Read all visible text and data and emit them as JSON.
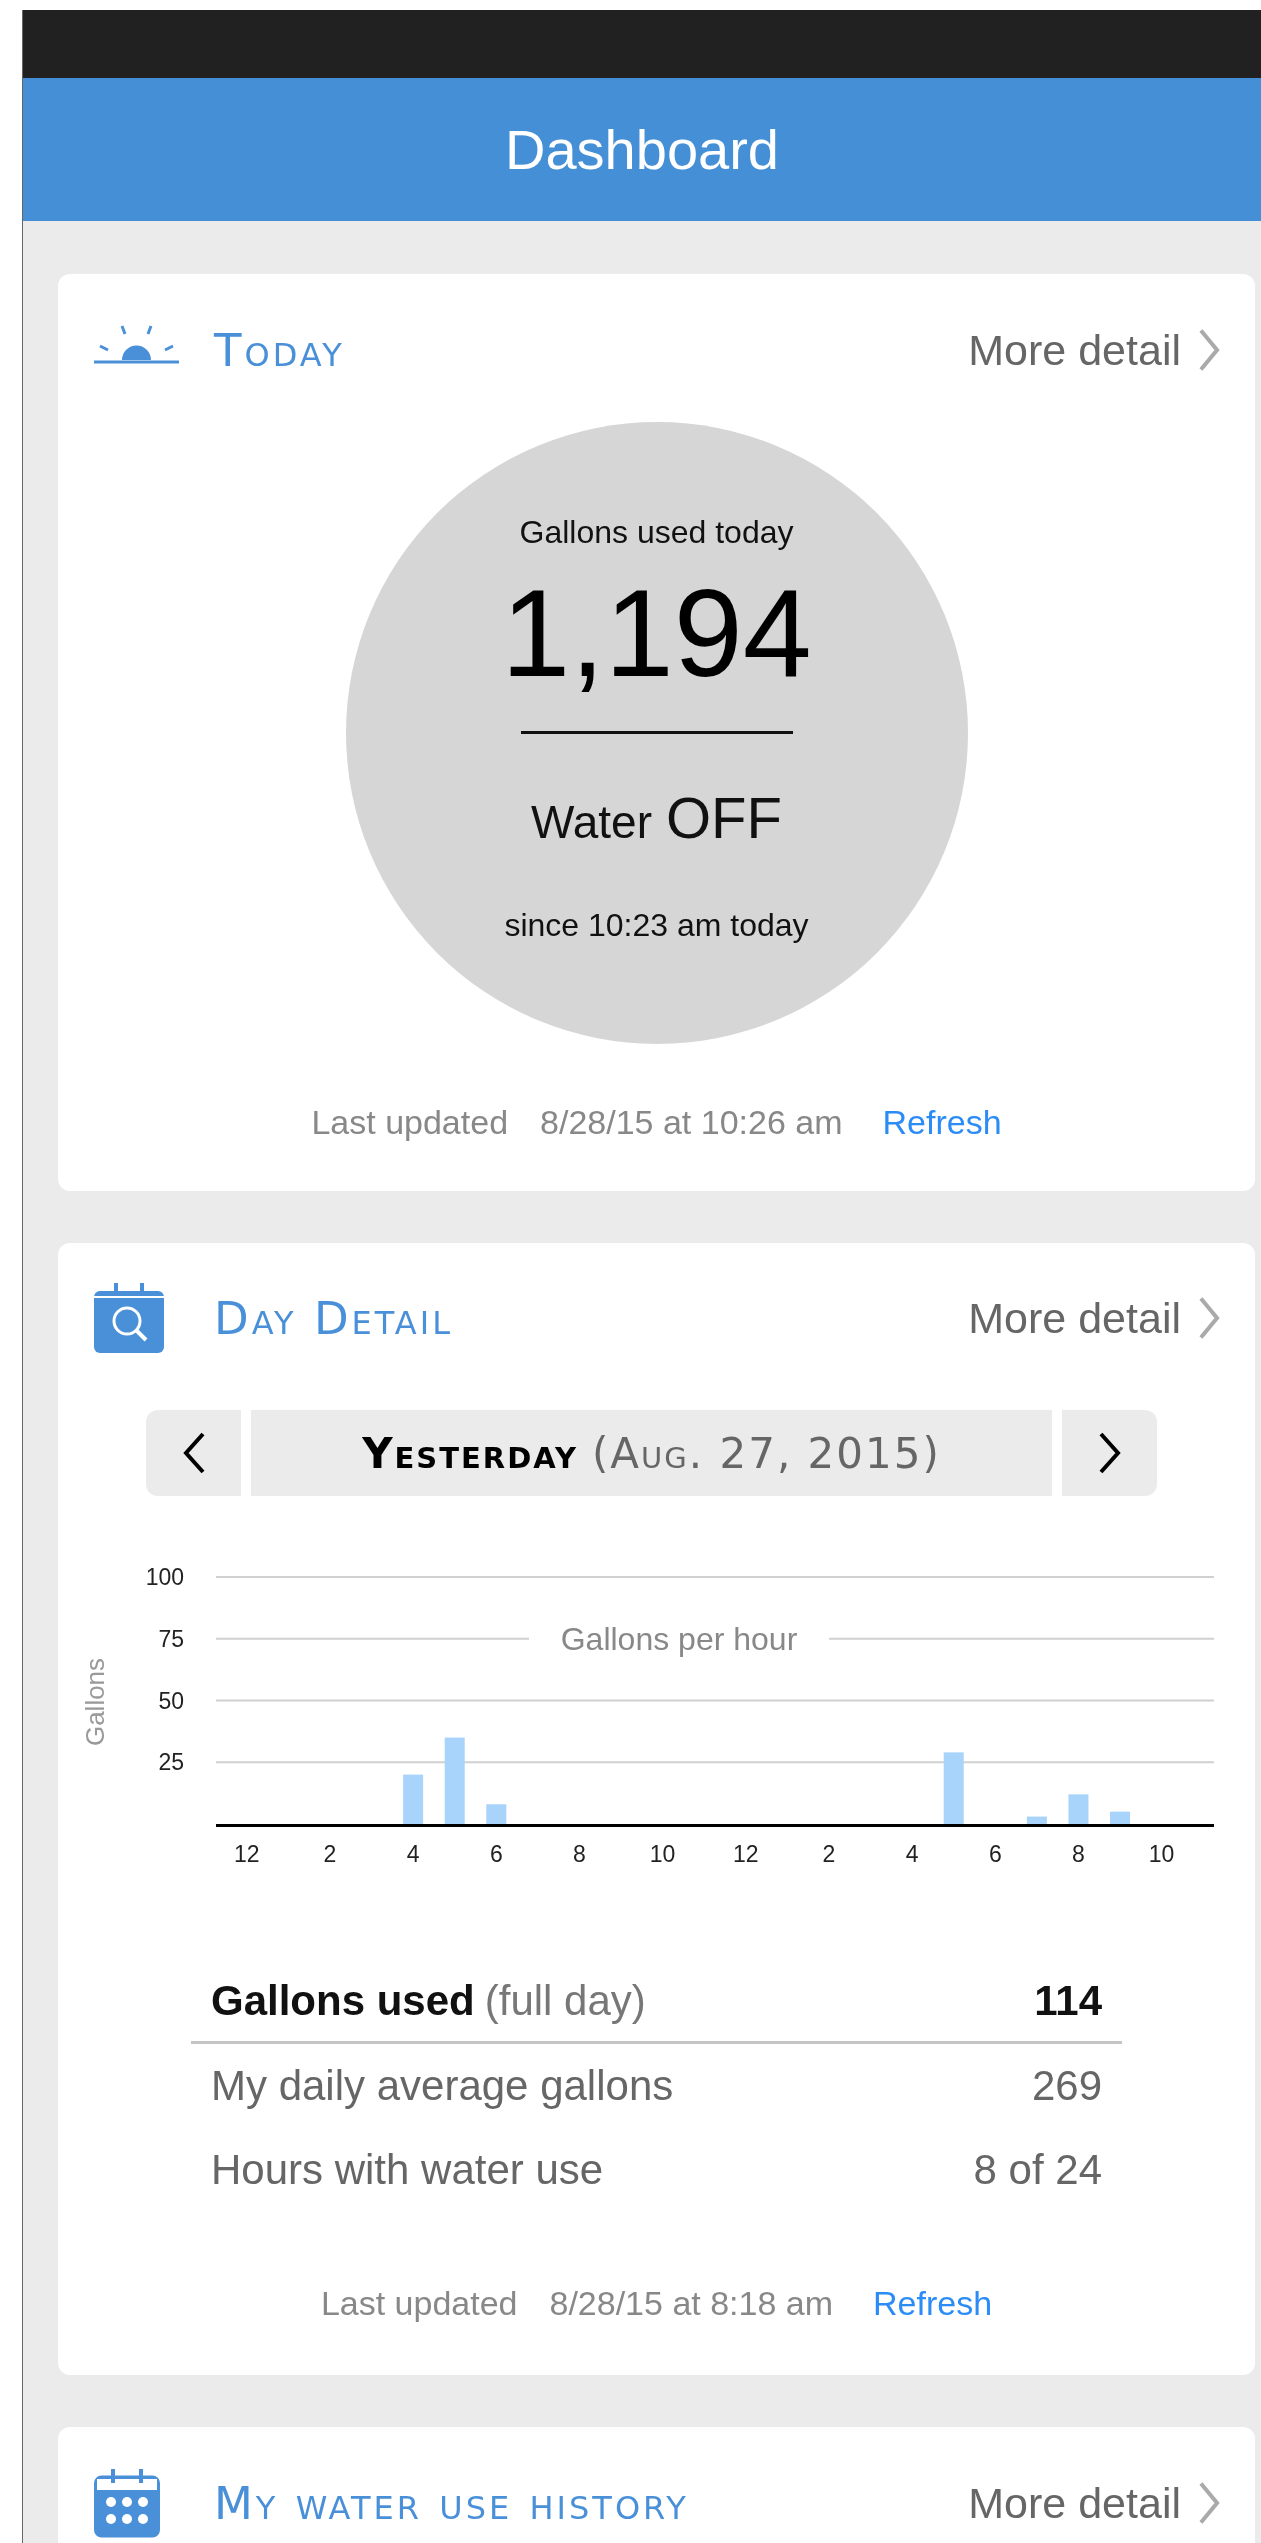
{
  "header": {
    "title": "Dashboard"
  },
  "today": {
    "title": "Today",
    "more": "More detail",
    "gauge": {
      "caption": "Gallons used today",
      "value": "1,194",
      "water_label": "Water",
      "water_state": "OFF",
      "since": "since 10:23 am today"
    },
    "updated": {
      "label": "Last updated",
      "time": "8/28/15 at 10:26 am",
      "action": "Refresh"
    }
  },
  "day_detail": {
    "title": "Day Detail",
    "more": "More detail",
    "day_nav": {
      "day": "Yesterday",
      "date": "(Aug. 27, 2015)"
    },
    "chart_data": {
      "type": "bar",
      "title": "Gallons per hour",
      "ylabel": "Gallons",
      "categories": [
        "12",
        null,
        "2",
        null,
        "4",
        null,
        "6",
        null,
        "8",
        null,
        "10",
        null,
        "12",
        null,
        "2",
        null,
        "4",
        null,
        "6",
        null,
        "8",
        null,
        "10",
        null
      ],
      "grid": true,
      "values": [
        0,
        0,
        0,
        0,
        20,
        35,
        8,
        0,
        0,
        0,
        0,
        0,
        0,
        0,
        0,
        0,
        0,
        29,
        0,
        3,
        12,
        5,
        0,
        0
      ],
      "ylim": [
        0,
        100
      ],
      "yticks": [
        25,
        50,
        75,
        100
      ]
    },
    "stats": [
      {
        "kind": "total",
        "label": "Gallons used",
        "note": "(full day)",
        "value": "114"
      },
      {
        "kind": "plain",
        "label": "My daily average gallons",
        "value": "269"
      },
      {
        "kind": "plain",
        "label": "Hours with water use",
        "value": "8 of 24"
      }
    ],
    "updated": {
      "label": "Last updated",
      "time": "8/28/15 at 8:18 am",
      "action": "Refresh"
    }
  },
  "history": {
    "title": "My water use history",
    "more": "More detail"
  }
}
